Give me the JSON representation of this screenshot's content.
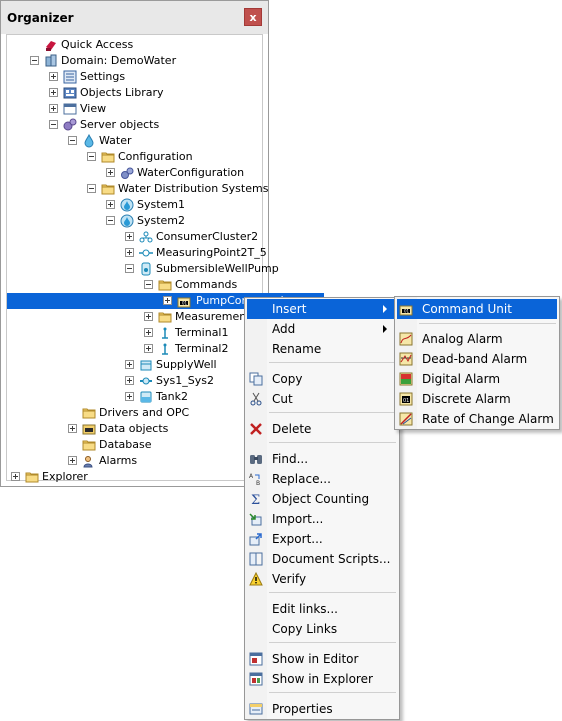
{
  "organizer": {
    "title": "Organizer",
    "close_glyph": "x",
    "tree": [
      {
        "label": "Quick Access",
        "icon": "quick-access-icon",
        "expander": "none",
        "selected": false
      },
      {
        "label": "Domain: DemoWater",
        "icon": "domain-icon",
        "expander": "minus",
        "selected": false
      },
      {
        "label": "Settings",
        "icon": "settings-icon",
        "expander": "plus",
        "selected": false
      },
      {
        "label": "Objects Library",
        "icon": "objects-library-icon",
        "expander": "plus",
        "selected": false
      },
      {
        "label": "View",
        "icon": "view-icon",
        "expander": "plus",
        "selected": false
      },
      {
        "label": "Server objects",
        "icon": "server-objects-icon",
        "expander": "minus",
        "selected": false
      },
      {
        "label": "Water",
        "icon": "water-drop-icon",
        "expander": "minus",
        "selected": false
      },
      {
        "label": "Configuration",
        "icon": "configuration-folder-icon",
        "expander": "minus",
        "selected": false
      },
      {
        "label": "WaterConfiguration",
        "icon": "gears-icon",
        "expander": "plus",
        "selected": false
      },
      {
        "label": "Water Distribution Systems",
        "icon": "systems-folder-icon",
        "expander": "minus",
        "selected": false
      },
      {
        "label": "System1",
        "icon": "system-drop-icon",
        "expander": "plus",
        "selected": false
      },
      {
        "label": "System2",
        "icon": "system-drop-icon",
        "expander": "minus",
        "selected": false
      },
      {
        "label": "ConsumerCluster2",
        "icon": "consumer-cluster-icon",
        "expander": "plus",
        "selected": false
      },
      {
        "label": "MeasuringPoint2T_5",
        "icon": "measuring-point-icon",
        "expander": "plus",
        "selected": false
      },
      {
        "label": "SubmersibleWellPump",
        "icon": "pump-icon",
        "expander": "minus",
        "selected": false
      },
      {
        "label": "Commands",
        "icon": "folder-icon",
        "expander": "minus",
        "selected": false
      },
      {
        "label": "PumpCommand",
        "icon": "command-unit-icon",
        "expander": "plus",
        "selected": true
      },
      {
        "label": "Measurements",
        "icon": "measurements-folder-icon",
        "expander": "plus",
        "selected": false
      },
      {
        "label": "Terminal1",
        "icon": "terminal-icon",
        "expander": "plus",
        "selected": false
      },
      {
        "label": "Terminal2",
        "icon": "terminal-icon",
        "expander": "plus",
        "selected": false
      },
      {
        "label": "SupplyWell",
        "icon": "supply-well-icon",
        "expander": "plus",
        "selected": false
      },
      {
        "label": "Sys1_Sys2",
        "icon": "pipe-icon",
        "expander": "plus",
        "selected": false
      },
      {
        "label": "Tank2",
        "icon": "tank-icon",
        "expander": "plus",
        "selected": false
      },
      {
        "label": "Drivers and OPC",
        "icon": "drivers-folder-icon",
        "expander": "none",
        "selected": false
      },
      {
        "label": "Data objects",
        "icon": "data-objects-icon",
        "expander": "plus",
        "selected": false
      },
      {
        "label": "Database",
        "icon": "database-folder-icon",
        "expander": "none",
        "selected": false
      },
      {
        "label": "Alarms",
        "icon": "alarms-icon",
        "expander": "plus",
        "selected": false
      },
      {
        "label": "Explorer",
        "icon": "explorer-folder-icon",
        "expander": "plus",
        "selected": false
      }
    ]
  },
  "context_menu": {
    "items": [
      {
        "label": "Insert",
        "icon": "",
        "submenu": true,
        "highlighted": true
      },
      {
        "label": "Add",
        "icon": "",
        "submenu": true,
        "highlighted": false
      },
      {
        "label": "Rename",
        "icon": "",
        "submenu": false,
        "highlighted": false
      },
      {
        "label": "Copy",
        "icon": "copy-icon",
        "submenu": false,
        "highlighted": false
      },
      {
        "label": "Cut",
        "icon": "scissors-icon",
        "submenu": false,
        "highlighted": false
      },
      {
        "label": "Delete",
        "icon": "delete-x-icon",
        "submenu": false,
        "highlighted": false
      },
      {
        "label": "Find...",
        "icon": "binoculars-icon",
        "submenu": false,
        "highlighted": false
      },
      {
        "label": "Replace...",
        "icon": "replace-icon",
        "submenu": false,
        "highlighted": false
      },
      {
        "label": "Object Counting",
        "icon": "sigma-icon",
        "submenu": false,
        "highlighted": false
      },
      {
        "label": "Import...",
        "icon": "import-icon",
        "submenu": false,
        "highlighted": false
      },
      {
        "label": "Export...",
        "icon": "export-icon",
        "submenu": false,
        "highlighted": false
      },
      {
        "label": "Document Scripts...",
        "icon": "document-scripts-icon",
        "submenu": false,
        "highlighted": false
      },
      {
        "label": "Verify",
        "icon": "warning-icon",
        "submenu": false,
        "highlighted": false
      },
      {
        "label": "Edit links...",
        "icon": "",
        "submenu": false,
        "highlighted": false
      },
      {
        "label": "Copy Links",
        "icon": "",
        "submenu": false,
        "highlighted": false
      },
      {
        "label": "Show in Editor",
        "icon": "show-in-editor-icon",
        "submenu": false,
        "highlighted": false
      },
      {
        "label": "Show in Explorer",
        "icon": "show-in-explorer-icon",
        "submenu": false,
        "highlighted": false
      },
      {
        "label": "Properties",
        "icon": "properties-icon",
        "submenu": false,
        "highlighted": false
      }
    ]
  },
  "insert_submenu": {
    "items": [
      {
        "label": "Command Unit",
        "icon": "command-unit-icon",
        "highlighted": true
      },
      {
        "label": "Analog Alarm",
        "icon": "analog-alarm-icon",
        "highlighted": false
      },
      {
        "label": "Dead-band Alarm",
        "icon": "deadband-alarm-icon",
        "highlighted": false
      },
      {
        "label": "Digital Alarm",
        "icon": "digital-alarm-icon",
        "highlighted": false
      },
      {
        "label": "Discrete Alarm",
        "icon": "discrete-alarm-icon",
        "highlighted": false
      },
      {
        "label": "Rate of Change Alarm",
        "icon": "rate-of-change-alarm-icon",
        "highlighted": false
      }
    ]
  },
  "colors": {
    "selection": "#0a64d8",
    "close_button": "#c0504d",
    "menu_bg": "#f7f7f7"
  }
}
